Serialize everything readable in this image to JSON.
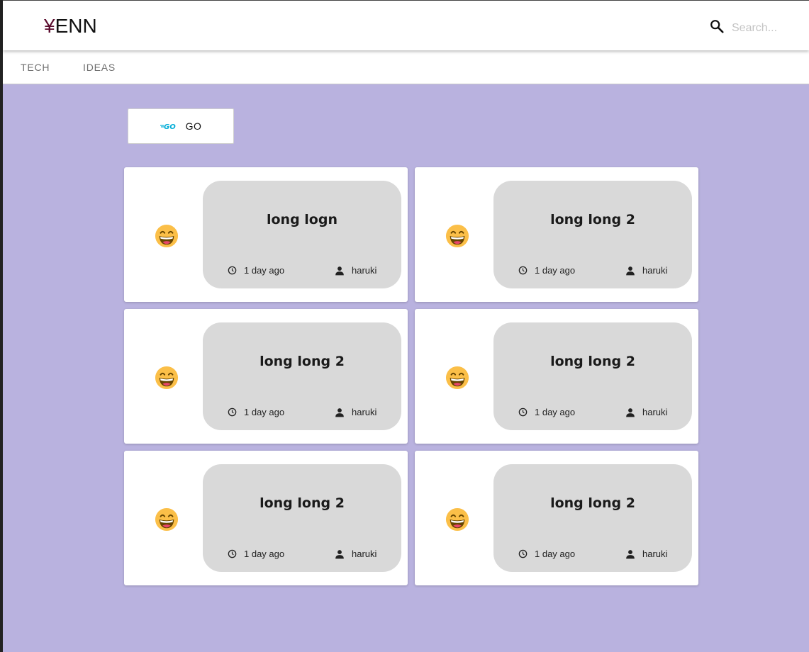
{
  "header": {
    "logo_symbol": "¥",
    "logo_text": "ENN",
    "search_placeholder": "Search..."
  },
  "tabs": [
    {
      "label": "TECH"
    },
    {
      "label": "IDEAS"
    }
  ],
  "category_chip": {
    "icon": "go-logo-icon",
    "label": "GO"
  },
  "posts": [
    {
      "emoji": "grinning-face-icon",
      "title": "long logn",
      "time": "1 day ago",
      "author": "haruki"
    },
    {
      "emoji": "grinning-face-icon",
      "title": "long long 2",
      "time": "1 day ago",
      "author": "haruki"
    },
    {
      "emoji": "grinning-face-icon",
      "title": "long long 2",
      "time": "1 day ago",
      "author": "haruki"
    },
    {
      "emoji": "grinning-face-icon",
      "title": "long long 2",
      "time": "1 day ago",
      "author": "haruki"
    },
    {
      "emoji": "grinning-face-icon",
      "title": "long long 2",
      "time": "1 day ago",
      "author": "haruki"
    },
    {
      "emoji": "grinning-face-icon",
      "title": "long long 2",
      "time": "1 day ago",
      "author": "haruki"
    }
  ],
  "colors": {
    "page_background": "#b9b2df",
    "card_panel": "#d9d9d9",
    "go_brand": "#00acd7"
  }
}
